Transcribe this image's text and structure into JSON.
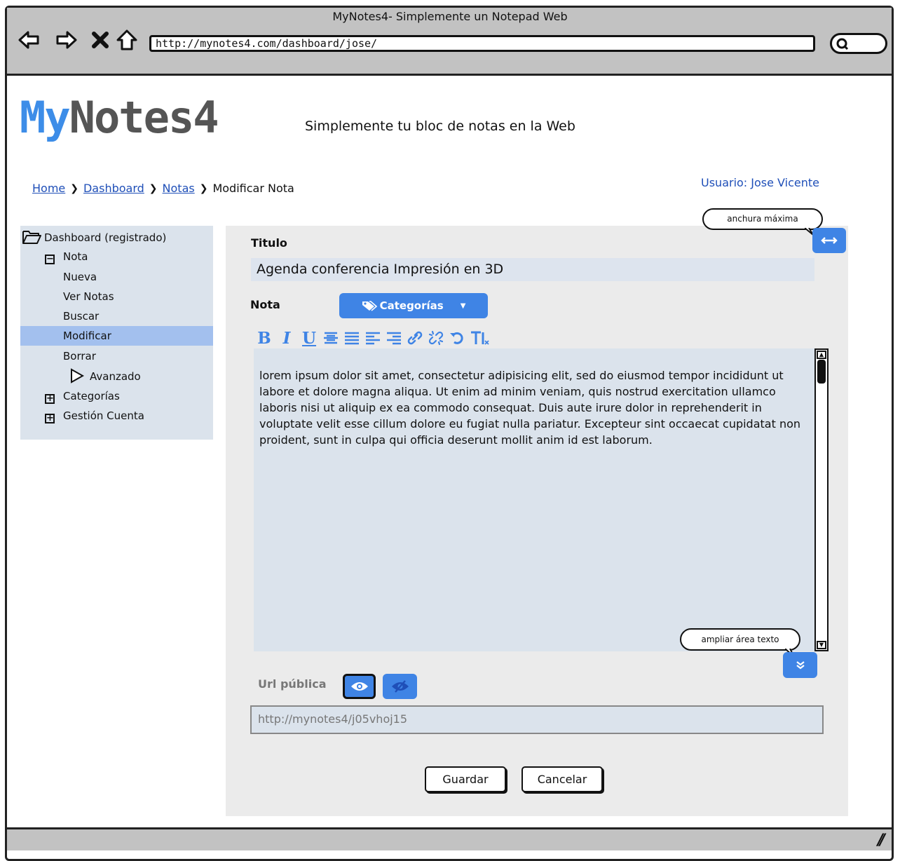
{
  "browser": {
    "window_title": "MyNotes4- Simplemente un Notepad Web",
    "url": "http://mynotes4.com/dashboard/jose/"
  },
  "header": {
    "logo_part1": "My",
    "logo_part2": "Notes4",
    "tagline": "Simplemente tu bloc de notas en la Web"
  },
  "breadcrumb": {
    "items": [
      "Home",
      "Dashboard",
      "Notas"
    ],
    "current": "Modificar Nota"
  },
  "user_label": "Usuario: Jose Vicente",
  "sidebar": {
    "root": "Dashboard (registrado)",
    "group_nota": "Nota",
    "items": [
      "Nueva",
      "Ver Notas",
      "Buscar",
      "Modificar",
      "Borrar"
    ],
    "selected": "Modificar",
    "advanced": "Avanzado",
    "categorias": "Categorías",
    "cuenta": "Gestión Cuenta"
  },
  "form": {
    "title_label": "Titulo",
    "title_value": "Agenda conferencia Impresión en 3D",
    "note_label": "Nota",
    "categories_button": "Categorías",
    "body_text": "lorem ipsum dolor sit amet, consectetur adipisicing elit, sed do eiusmod tempor incididunt ut labore et dolore magna aliqua. Ut enim ad minim veniam, quis nostrud exercitation ullamco laboris nisi ut aliquip ex ea commodo consequat. Duis aute irure dolor in reprehenderit in voluptate velit esse cillum dolore eu fugiat nulla pariatur. Excepteur sint occaecat cupidatat non proident, sunt in culpa qui officia deserunt mollit anim id est laborum.",
    "toolbar": [
      "B",
      "I",
      "U"
    ],
    "url_label": "Url pública",
    "public_url": "http://mynotes4/j05vhoj15",
    "save_button": "Guardar",
    "cancel_button": "Cancelar"
  },
  "callouts": {
    "max_width": "anchura máxima",
    "enlarge_text": "ampliar área texto"
  },
  "colors": {
    "accent": "#3f84e5",
    "panel_bg": "#ebebeb",
    "field_bg": "#dbe3ec",
    "link": "#1f4fb8"
  }
}
